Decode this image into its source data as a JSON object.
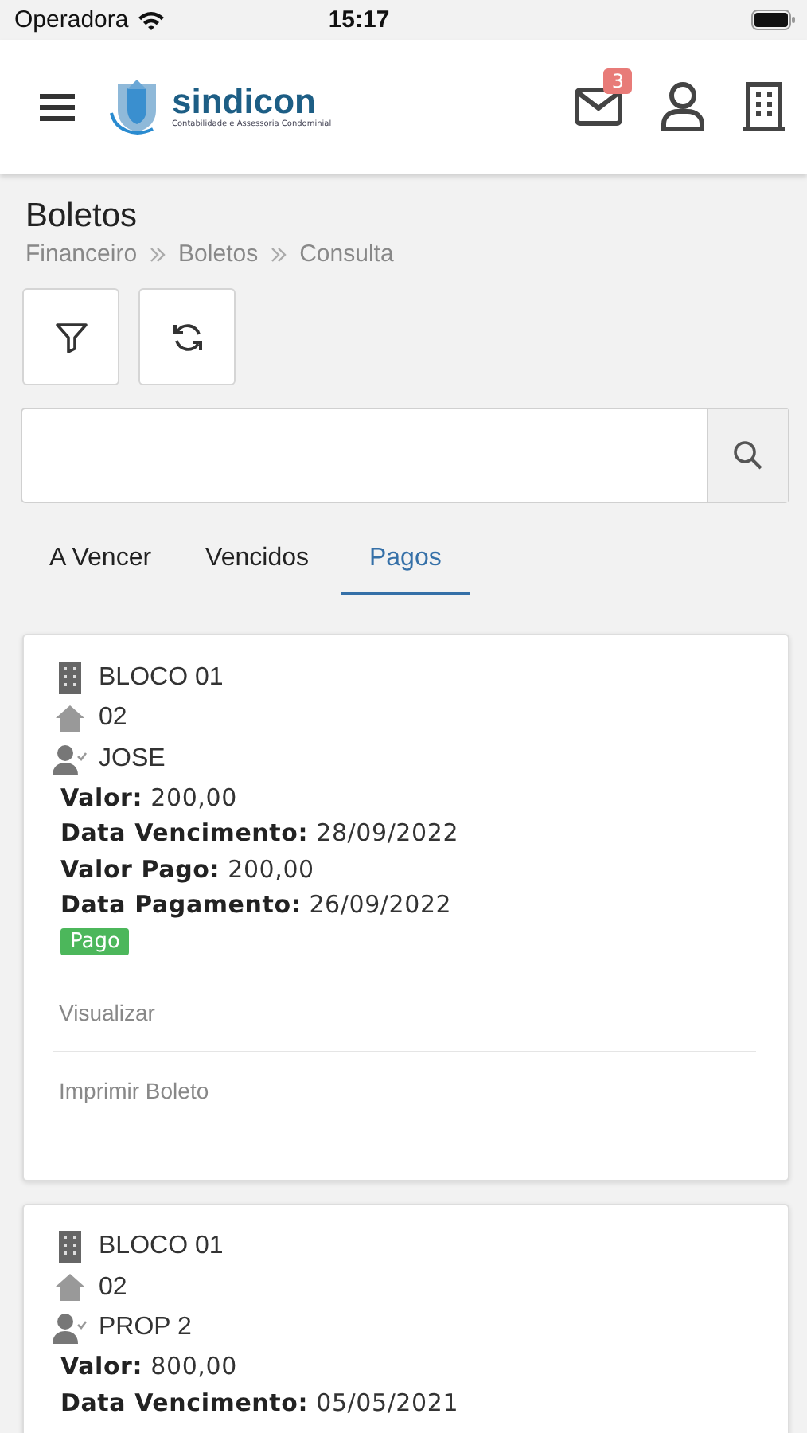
{
  "status_bar": {
    "carrier": "Operadora",
    "time": "15:17"
  },
  "header": {
    "logo": {
      "name": "sindicon",
      "tagline": "Contabilidade e Assessoria Condominial"
    },
    "message_badge": "3"
  },
  "page": {
    "title": "Boletos",
    "breadcrumb": [
      "Financeiro",
      "Boletos",
      "Consulta"
    ]
  },
  "tabs": [
    {
      "label": "A Vencer",
      "selected": false
    },
    {
      "label": "Vencidos",
      "selected": false
    },
    {
      "label": "Pagos",
      "selected": true
    }
  ],
  "cards": [
    {
      "block": "BLOCO 01",
      "unit": "02",
      "person": "JOSE",
      "details": [
        "**Valor:** 200,00",
        "**Data Vencimento:** 28/09/2022",
        "**Valor Pago:** 200,00",
        "**Data Pagamento:** 26/09/2022"
      ],
      "status": "Pago",
      "color": "#4cb75b",
      "actions": [
        "Visualizar",
        "Imprimir Boleto"
      ]
    },
    {
      "block": "BLOCO 01",
      "unit": "02",
      "person": "PROP 2",
      "details": [
        "**Valor:** 800,00",
        "**Data Vencimento:** 05/05/2021"
      ]
    }
  ]
}
